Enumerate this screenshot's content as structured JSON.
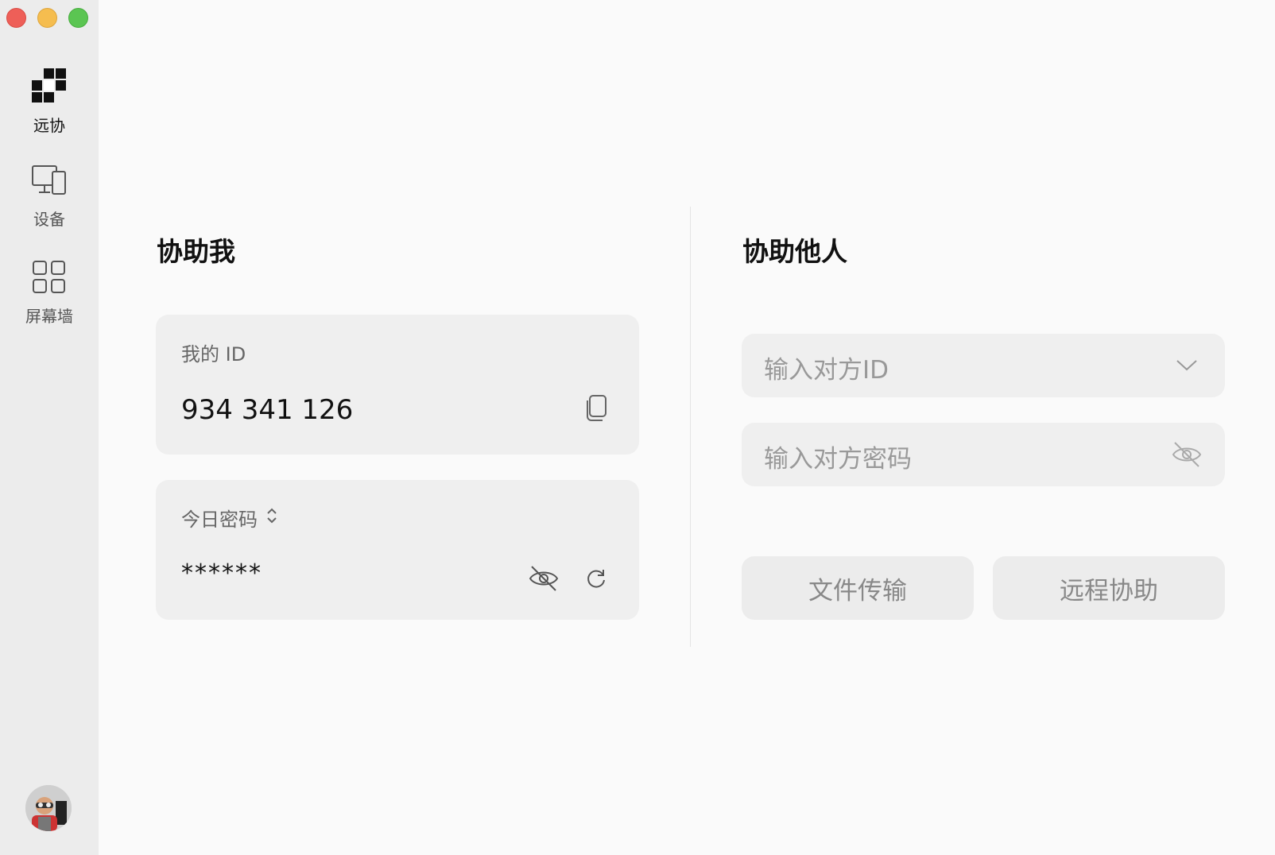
{
  "window": {
    "controls": [
      "close",
      "minimize",
      "maximize"
    ]
  },
  "sidebar": {
    "items": [
      {
        "label": "远协",
        "icon": "remote-assist-logo-icon",
        "active": true
      },
      {
        "label": "设备",
        "icon": "devices-icon",
        "active": false
      },
      {
        "label": "屏幕墙",
        "icon": "screen-wall-grid-icon",
        "active": false
      }
    ],
    "avatar": "user-avatar"
  },
  "help_me": {
    "title": "协助我",
    "id_card": {
      "label": "我的 ID",
      "value": "934 341 126",
      "action_icon": "copy-icon"
    },
    "password_card": {
      "label": "今日密码",
      "label_icon": "sort-updown-icon",
      "value": "******",
      "actions": [
        "eye-hidden-icon",
        "refresh-icon"
      ]
    }
  },
  "help_others": {
    "title": "协助他人",
    "id_input": {
      "placeholder": "输入对方ID",
      "icon": "chevron-down-icon"
    },
    "password_input": {
      "placeholder": "输入对方密码",
      "icon": "eye-hidden-icon"
    },
    "buttons": {
      "file_transfer": "文件传输",
      "remote_assist": "远程协助"
    }
  },
  "colors": {
    "sidebar_bg": "#ececec",
    "main_bg": "#fafafa",
    "card_bg": "#efefef",
    "close": "#ee5f58",
    "minimize": "#f5bd4f",
    "maximize": "#5bc552"
  }
}
